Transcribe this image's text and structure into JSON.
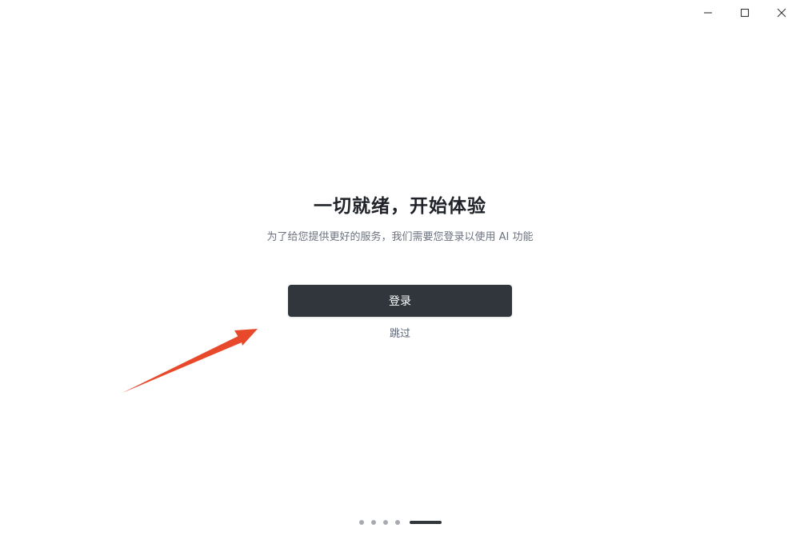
{
  "window": {
    "controls": [
      "minimize-icon",
      "maximize-icon",
      "close-icon"
    ]
  },
  "onboarding": {
    "title": "一切就绪，开始体验",
    "subtitle": "为了给您提供更好的服务，我们需要您登录以使用 AI 功能",
    "login_label": "登录",
    "skip_label": "跳过"
  },
  "pager": {
    "total_steps": 5,
    "current_step": 5
  },
  "colors": {
    "button_bg": "#31363d",
    "arrow": "#e8492b",
    "dot_inactive": "#a7abb1"
  },
  "annotation": {
    "icon": "red-arrow-icon"
  }
}
